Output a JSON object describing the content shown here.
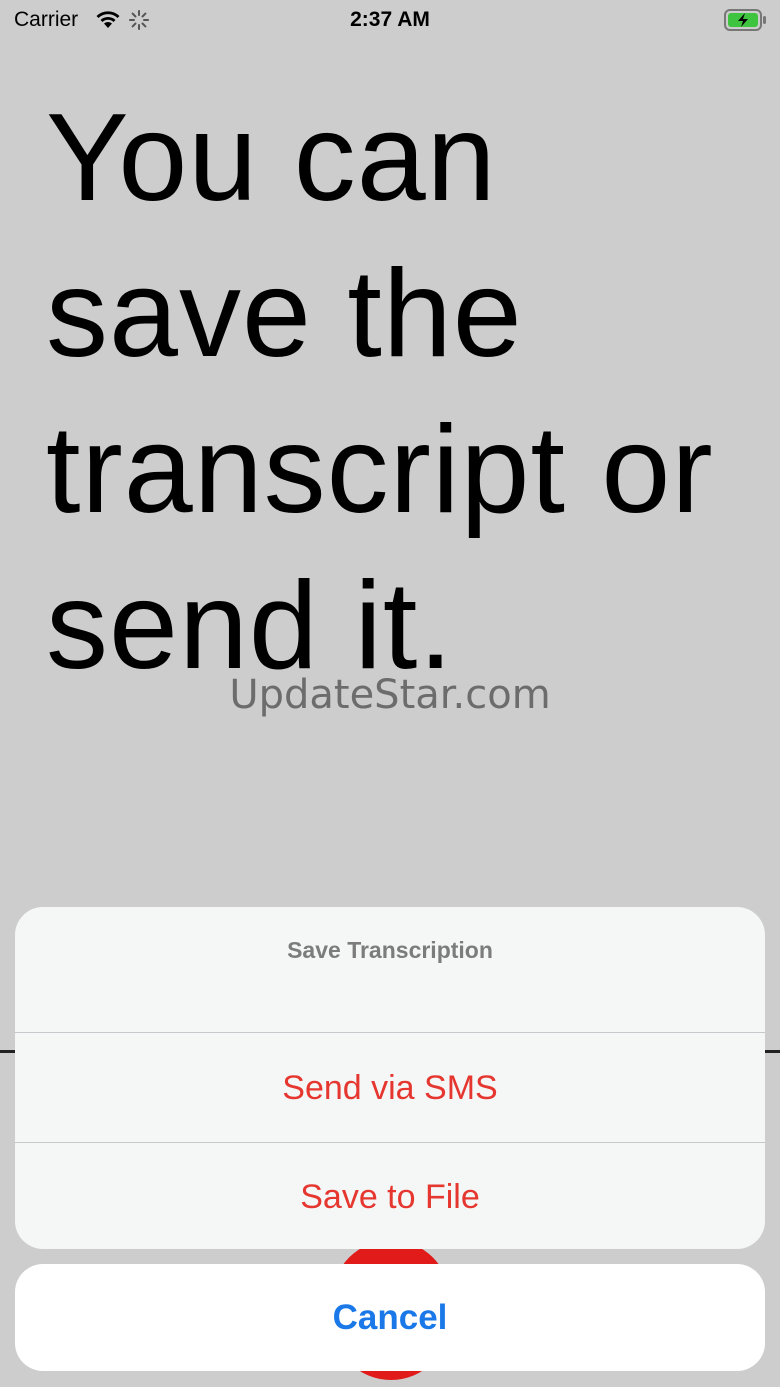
{
  "status_bar": {
    "carrier": "Carrier",
    "time": "2:37 AM",
    "icons": [
      "wifi-icon",
      "activity-spinner-icon",
      "battery-charging-icon"
    ],
    "battery_color": "#3ec43e"
  },
  "main": {
    "headline": "You can save the transcript or send it.",
    "watermark": "UpdateStar.com"
  },
  "action_sheet": {
    "title": "Save Transcription",
    "options": [
      {
        "label": "Send via SMS"
      },
      {
        "label": "Save to File"
      }
    ],
    "cancel_label": "Cancel",
    "colors": {
      "destructive": "#e5372f",
      "cancel": "#1a78e8",
      "record_button": "#e11a1a"
    }
  }
}
